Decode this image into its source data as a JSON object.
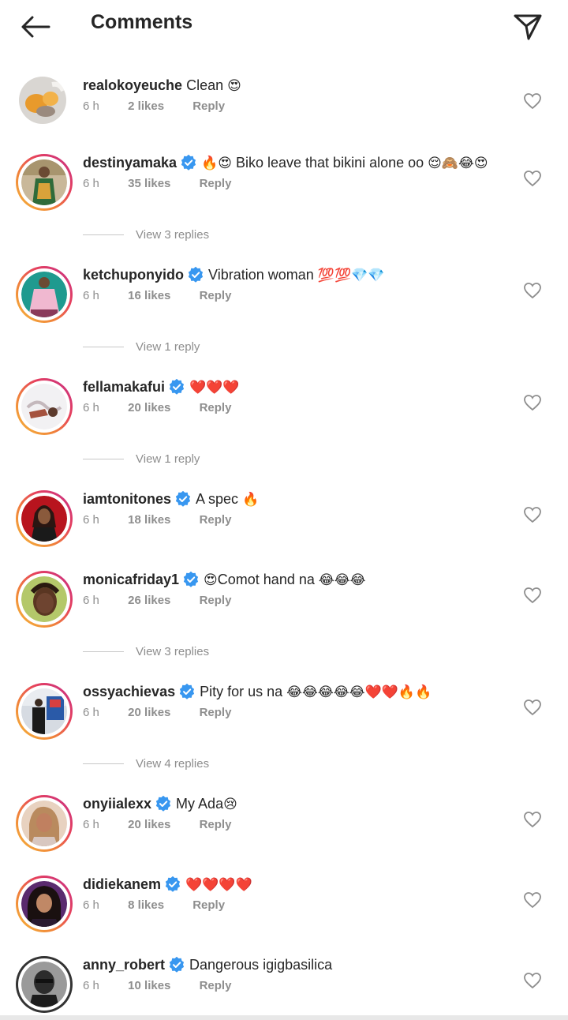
{
  "header": {
    "back_icon": "arrow-left-icon",
    "title": "Comments",
    "send_icon": "paper-plane-icon"
  },
  "colors": {
    "text": "#262626",
    "muted": "#8e8e8e",
    "verified_blue": "#3897f0",
    "story_ring_start": "#f6b83a",
    "story_ring_end": "#c42f8a"
  },
  "comments": [
    {
      "username": "realokoyeuche",
      "verified": false,
      "text": "Clean",
      "emoji": "😍",
      "time": "6 h",
      "likes": "2 likes",
      "reply": "Reply",
      "view_replies": ""
    },
    {
      "username": "destinyamaka",
      "verified": true,
      "text_pre_emoji": "🔥😍",
      "text": "Biko leave that bikini alone oo",
      "emoji": "😌🙈😂😍",
      "time": "6 h",
      "likes": "35 likes",
      "reply": "Reply",
      "view_replies": "View 3 replies"
    },
    {
      "username": "ketchuponyido",
      "verified": true,
      "text": "Vibration woman",
      "emoji": "💯💯💎💎",
      "time": "6 h",
      "likes": "16 likes",
      "reply": "Reply",
      "view_replies": "View 1 reply"
    },
    {
      "username": "fellamakafui",
      "verified": true,
      "text": "",
      "emoji": "❤️❤️❤️",
      "time": "6 h",
      "likes": "20 likes",
      "reply": "Reply",
      "view_replies": "View 1 reply"
    },
    {
      "username": "iamtonitones",
      "verified": true,
      "text": "A spec",
      "emoji": "🔥",
      "time": "6 h",
      "likes": "18 likes",
      "reply": "Reply",
      "view_replies": ""
    },
    {
      "username": "monicafriday1",
      "verified": true,
      "text_pre_emoji": "😍",
      "text": "Comot hand na",
      "emoji": "😂😂😂",
      "time": "6 h",
      "likes": "26 likes",
      "reply": "Reply",
      "view_replies": "View 3 replies"
    },
    {
      "username": "ossyachievas",
      "verified": true,
      "text": "Pity for us na",
      "emoji": "😂😂😂😂😂❤️❤️🔥🔥",
      "time": "6 h",
      "likes": "20 likes",
      "reply": "Reply",
      "view_replies": "View 4 replies"
    },
    {
      "username": "onyiialexx",
      "verified": true,
      "text": "My Ada",
      "emoji": "😢",
      "time": "6 h",
      "likes": "20 likes",
      "reply": "Reply",
      "view_replies": ""
    },
    {
      "username": "didiekanem",
      "verified": true,
      "text": "",
      "emoji": "❤️❤️❤️❤️",
      "time": "6 h",
      "likes": "8 likes",
      "reply": "Reply",
      "view_replies": ""
    },
    {
      "username": "anny_robert",
      "verified": true,
      "text": "Dangerous igigbasilica",
      "emoji": "",
      "time": "6 h",
      "likes": "10 likes",
      "reply": "Reply",
      "view_replies": ""
    }
  ]
}
